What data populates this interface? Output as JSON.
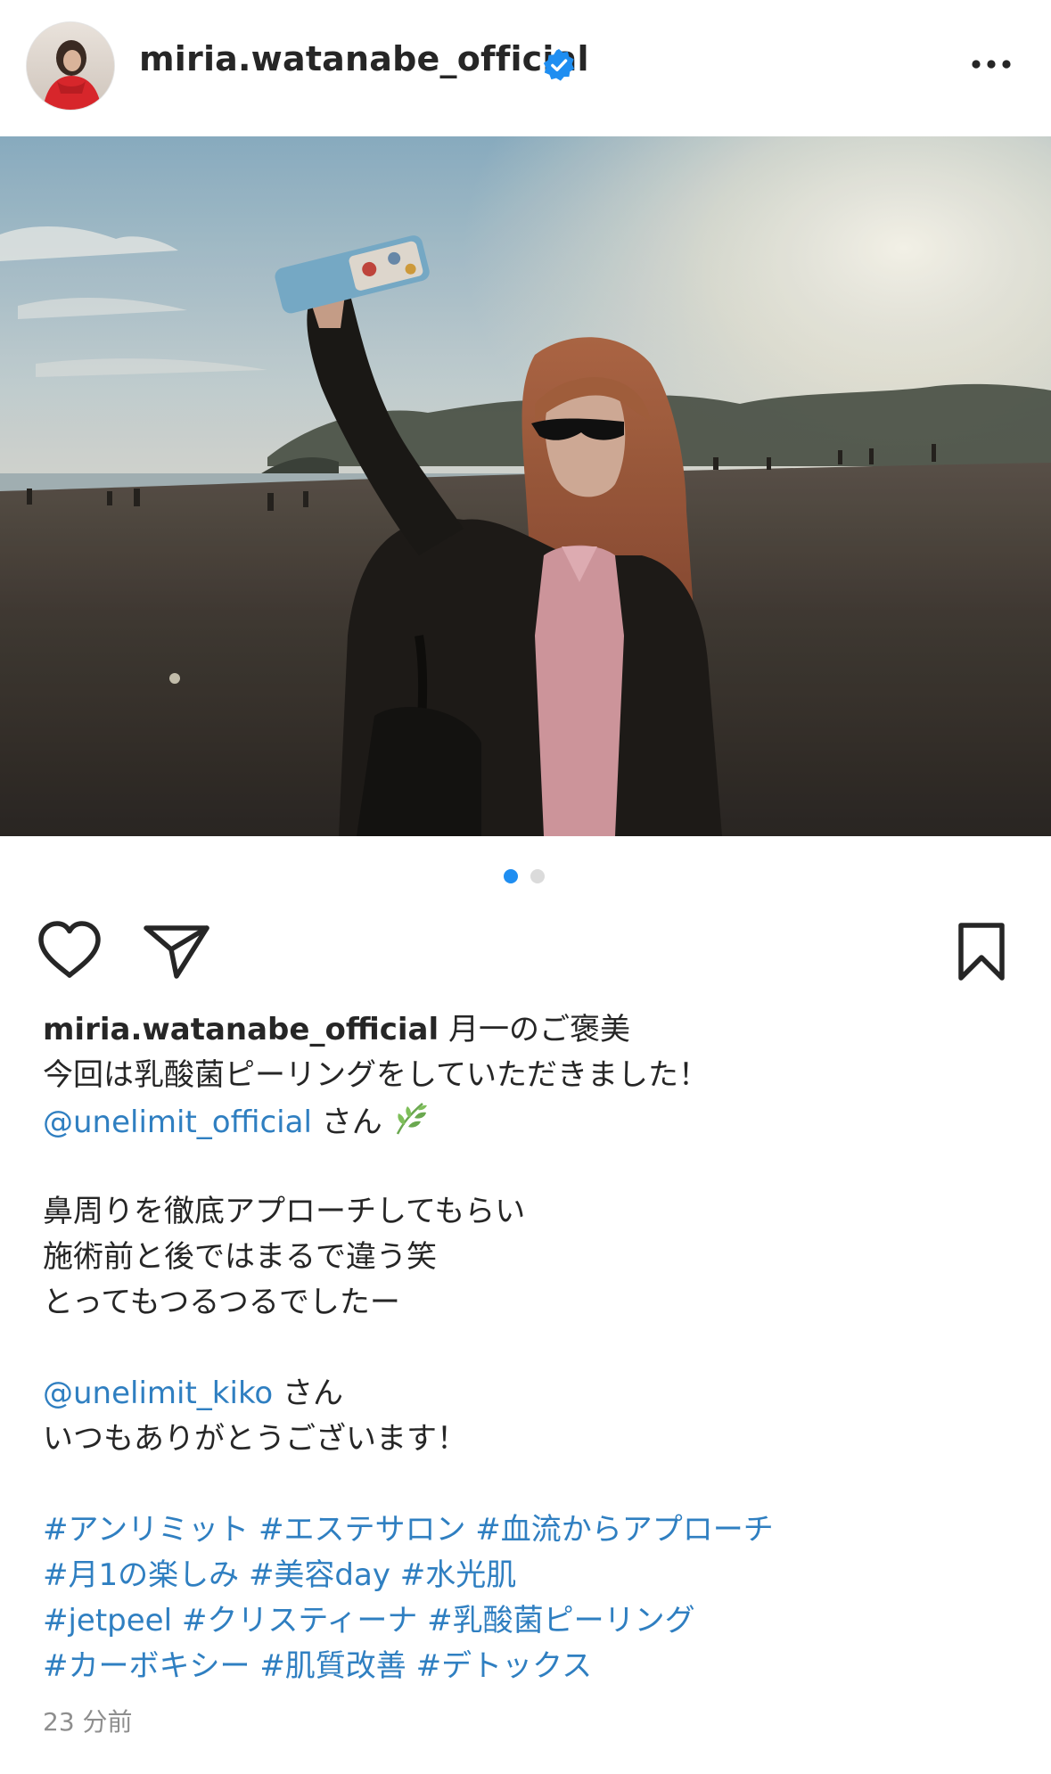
{
  "post": {
    "username": "miria.watanabe_official",
    "verified_icon": "verified-badge-icon",
    "more_icon": "more-options-icon",
    "carousel": {
      "count": 2,
      "active_index": 0,
      "active_color": "#1f8ef1",
      "inactive_color": "#dbdbdb"
    },
    "actions": {
      "like_icon": "heart-outline-icon",
      "share_icon": "paper-plane-icon",
      "save_icon": "bookmark-outline-icon"
    },
    "caption": {
      "username": "miria.watanabe_official",
      "line1_text": " 月一のご褒美",
      "line2": "今回は乳酸菌ピーリングをしていただきました！",
      "mention1": "@unelimit_official",
      "mention1_suffix": " さん",
      "leaf_emoji": "🌿",
      "line4": "鼻周りを徹底アプローチしてもらい",
      "line5": "施術前と後ではまるで違う笑",
      "line6": "とってもつるつるでしたー",
      "mention2": "@unelimit_kiko",
      "mention2_suffix": " さん",
      "line8": "いつもありがとうございます！",
      "hashtag_lines": [
        [
          "#アンリミット",
          "#エステサロン",
          "#血流からアプローチ"
        ],
        [
          "#月1の楽しみ",
          "#美容day",
          "#水光肌"
        ],
        [
          "#jetpeel",
          "#クリスティーナ",
          "#乳酸菌ピーリング"
        ],
        [
          "#カーボキシー",
          "#肌質改善",
          "#デトックス"
        ]
      ]
    },
    "timestamp": "23 分前",
    "colors": {
      "link": "#2f7fc1",
      "text": "#262626",
      "muted": "#8e8e8e"
    }
  }
}
